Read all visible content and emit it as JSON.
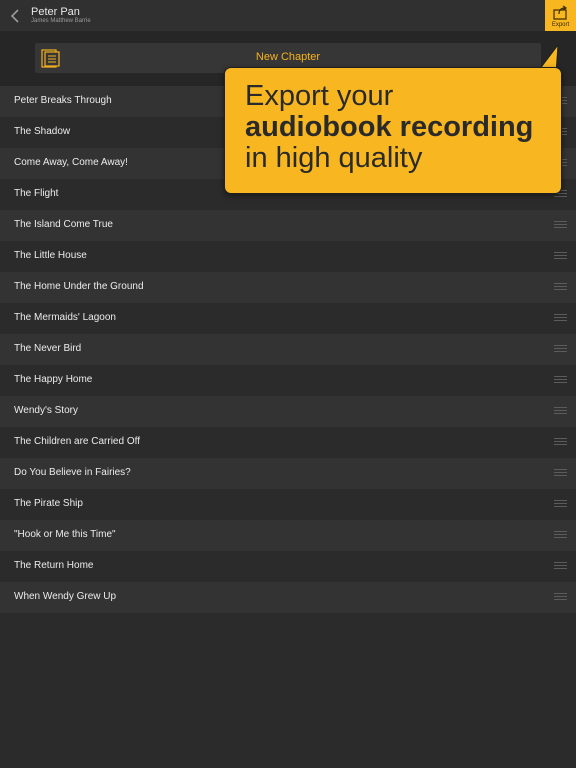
{
  "header": {
    "book_title": "Peter Pan",
    "book_author": "James Matthew Barrie",
    "export_label": "Export"
  },
  "new_chapter_label": "New Chapter",
  "promo": {
    "line1": "Export your",
    "line2": "audiobook recording",
    "line3": "in high quality"
  },
  "chapters": [
    "Peter Breaks Through",
    "The Shadow",
    "Come Away, Come Away!",
    "The Flight",
    "The Island Come True",
    "The Little House",
    "The Home Under the Ground",
    "The Mermaids' Lagoon",
    "The Never Bird",
    "The Happy Home",
    "Wendy's Story",
    "The Children are Carried Off",
    "Do You Believe in Fairies?",
    "The Pirate Ship",
    "\"Hook or Me this Time\"",
    "The Return Home",
    "When Wendy Grew Up"
  ],
  "colors": {
    "accent": "#f8b721",
    "background": "#2b2b2b"
  }
}
